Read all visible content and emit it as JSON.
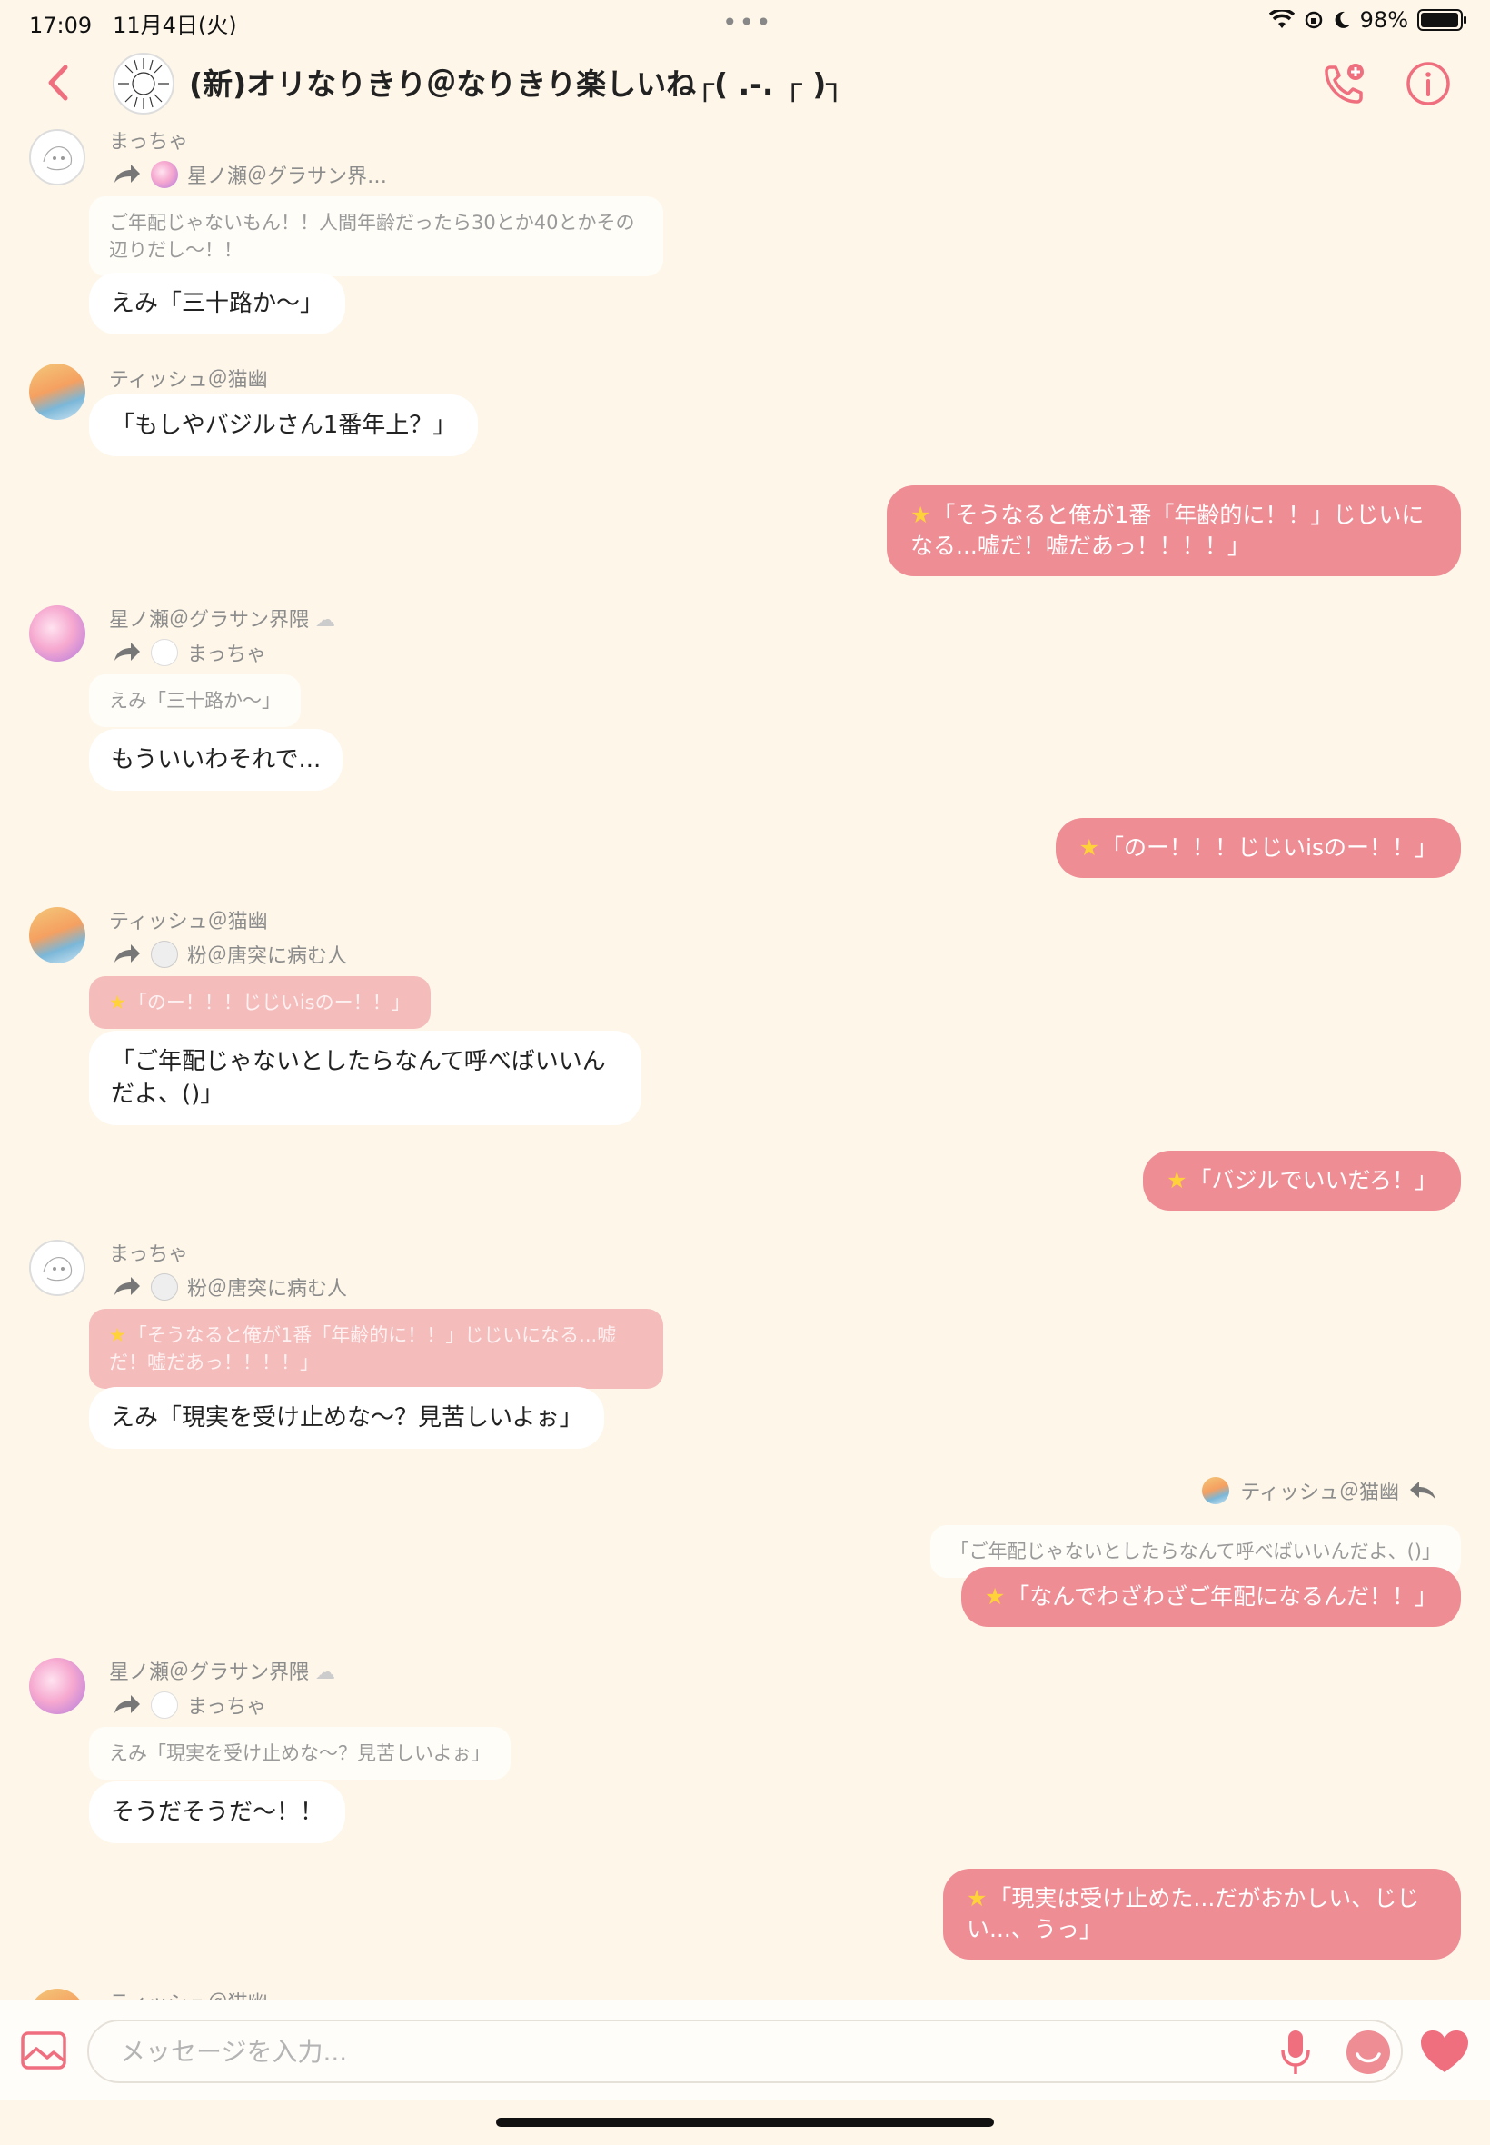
{
  "status_bar": {
    "time": "17:09",
    "date": "11月4日(火)",
    "battery": "98%",
    "battery_level": 0.98
  },
  "header": {
    "title": "(新)オリなりきり＠なりきり楽しいね┌( .-. ┌ )┐"
  },
  "messages": [
    {
      "type": "incoming",
      "avatar": "maccha",
      "sender": "まっちゃ",
      "forward_from": "星ノ瀬＠グラサン界…",
      "quote": "ご年配じゃないもん！！人間年齢だったら30とか40とかその辺りだし〜！！",
      "text": "えみ「三十路か〜」"
    },
    {
      "type": "incoming",
      "avatar": "tissue",
      "sender": "ティッシュ＠猫幽",
      "text": "「もしやバジルさん1番年上？」"
    },
    {
      "type": "outgoing",
      "text": "「そうなると俺が1番「年齢的に！！」じじいになる...嘘だ！嘘だあっ！！！！」"
    },
    {
      "type": "incoming",
      "avatar": "hoshi",
      "sender": "星ノ瀬＠グラサン界隈",
      "forward_from": "まっちゃ",
      "quote": "えみ「三十路か〜」",
      "text": "もういいわそれで..."
    },
    {
      "type": "outgoing",
      "text": "「のー！！！じじいisのー！！」"
    },
    {
      "type": "incoming",
      "avatar": "tissue",
      "sender": "ティッシュ＠猫幽",
      "forward_from": "粉＠唐突に病む人",
      "quote": "「のー！！！じじいisのー！！」",
      "text": "「ご年配じゃないとしたらなんて呼べばいいんだよ、()」"
    },
    {
      "type": "outgoing",
      "text": "「バジルでいいだろ！」"
    },
    {
      "type": "incoming",
      "avatar": "maccha",
      "sender": "まっちゃ",
      "forward_from": "粉＠唐突に病む人",
      "quote": "「そうなると俺が1番「年齢的に！！」じじいになる...嘘だ！嘘だあっ！！！！」",
      "text": "えみ「現実を受け止めな〜？見苦しいよぉ」"
    },
    {
      "type": "outgoing",
      "reply_to": "ティッシュ＠猫幽",
      "reply_quote": "「ご年配じゃないとしたらなんて呼べばいいんだよ、()」",
      "text": "「なんでわざわざご年配になるんだ！！」"
    },
    {
      "type": "incoming",
      "avatar": "hoshi",
      "sender": "星ノ瀬＠グラサン界隈",
      "forward_from": "まっちゃ",
      "quote": "えみ「現実を受け止めな〜？見苦しいよぉ」",
      "text": "そうだそうだ〜！！"
    },
    {
      "type": "outgoing",
      "text": "「現実は受け止めた...だがおかしい、じじい...、うっ」"
    },
    {
      "type": "incoming",
      "avatar": "tissue",
      "sender": "ティッシュ＠猫幽"
    }
  ],
  "input": {
    "placeholder": "メッセージを入力..."
  },
  "icons": {
    "back": "chevron-left-icon",
    "call": "phone-add-icon",
    "info": "info-icon",
    "image": "image-icon",
    "mic": "microphone-icon",
    "emoji": "emoji-icon",
    "heart": "heart-icon",
    "forward": "forward-arrow-icon",
    "reply": "reply-arrow-icon",
    "star": "star-icon"
  },
  "colors": {
    "background": "#fdf6e9",
    "accent": "#ef8d95",
    "quote_pink": "#f5bcbc",
    "bubble_in": "#ffffff",
    "star": "#ffd23a"
  }
}
